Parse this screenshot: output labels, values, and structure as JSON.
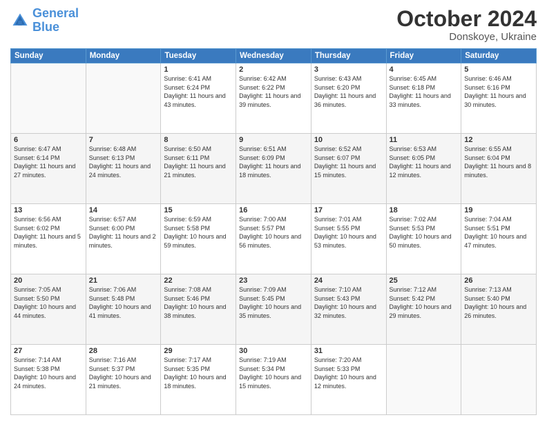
{
  "header": {
    "logo_line1": "General",
    "logo_line2": "Blue",
    "month": "October 2024",
    "location": "Donskoye, Ukraine"
  },
  "days_of_week": [
    "Sunday",
    "Monday",
    "Tuesday",
    "Wednesday",
    "Thursday",
    "Friday",
    "Saturday"
  ],
  "weeks": [
    [
      {
        "day": "",
        "info": ""
      },
      {
        "day": "",
        "info": ""
      },
      {
        "day": "1",
        "info": "Sunrise: 6:41 AM\nSunset: 6:24 PM\nDaylight: 11 hours and 43 minutes."
      },
      {
        "day": "2",
        "info": "Sunrise: 6:42 AM\nSunset: 6:22 PM\nDaylight: 11 hours and 39 minutes."
      },
      {
        "day": "3",
        "info": "Sunrise: 6:43 AM\nSunset: 6:20 PM\nDaylight: 11 hours and 36 minutes."
      },
      {
        "day": "4",
        "info": "Sunrise: 6:45 AM\nSunset: 6:18 PM\nDaylight: 11 hours and 33 minutes."
      },
      {
        "day": "5",
        "info": "Sunrise: 6:46 AM\nSunset: 6:16 PM\nDaylight: 11 hours and 30 minutes."
      }
    ],
    [
      {
        "day": "6",
        "info": "Sunrise: 6:47 AM\nSunset: 6:14 PM\nDaylight: 11 hours and 27 minutes."
      },
      {
        "day": "7",
        "info": "Sunrise: 6:48 AM\nSunset: 6:13 PM\nDaylight: 11 hours and 24 minutes."
      },
      {
        "day": "8",
        "info": "Sunrise: 6:50 AM\nSunset: 6:11 PM\nDaylight: 11 hours and 21 minutes."
      },
      {
        "day": "9",
        "info": "Sunrise: 6:51 AM\nSunset: 6:09 PM\nDaylight: 11 hours and 18 minutes."
      },
      {
        "day": "10",
        "info": "Sunrise: 6:52 AM\nSunset: 6:07 PM\nDaylight: 11 hours and 15 minutes."
      },
      {
        "day": "11",
        "info": "Sunrise: 6:53 AM\nSunset: 6:05 PM\nDaylight: 11 hours and 12 minutes."
      },
      {
        "day": "12",
        "info": "Sunrise: 6:55 AM\nSunset: 6:04 PM\nDaylight: 11 hours and 8 minutes."
      }
    ],
    [
      {
        "day": "13",
        "info": "Sunrise: 6:56 AM\nSunset: 6:02 PM\nDaylight: 11 hours and 5 minutes."
      },
      {
        "day": "14",
        "info": "Sunrise: 6:57 AM\nSunset: 6:00 PM\nDaylight: 11 hours and 2 minutes."
      },
      {
        "day": "15",
        "info": "Sunrise: 6:59 AM\nSunset: 5:58 PM\nDaylight: 10 hours and 59 minutes."
      },
      {
        "day": "16",
        "info": "Sunrise: 7:00 AM\nSunset: 5:57 PM\nDaylight: 10 hours and 56 minutes."
      },
      {
        "day": "17",
        "info": "Sunrise: 7:01 AM\nSunset: 5:55 PM\nDaylight: 10 hours and 53 minutes."
      },
      {
        "day": "18",
        "info": "Sunrise: 7:02 AM\nSunset: 5:53 PM\nDaylight: 10 hours and 50 minutes."
      },
      {
        "day": "19",
        "info": "Sunrise: 7:04 AM\nSunset: 5:51 PM\nDaylight: 10 hours and 47 minutes."
      }
    ],
    [
      {
        "day": "20",
        "info": "Sunrise: 7:05 AM\nSunset: 5:50 PM\nDaylight: 10 hours and 44 minutes."
      },
      {
        "day": "21",
        "info": "Sunrise: 7:06 AM\nSunset: 5:48 PM\nDaylight: 10 hours and 41 minutes."
      },
      {
        "day": "22",
        "info": "Sunrise: 7:08 AM\nSunset: 5:46 PM\nDaylight: 10 hours and 38 minutes."
      },
      {
        "day": "23",
        "info": "Sunrise: 7:09 AM\nSunset: 5:45 PM\nDaylight: 10 hours and 35 minutes."
      },
      {
        "day": "24",
        "info": "Sunrise: 7:10 AM\nSunset: 5:43 PM\nDaylight: 10 hours and 32 minutes."
      },
      {
        "day": "25",
        "info": "Sunrise: 7:12 AM\nSunset: 5:42 PM\nDaylight: 10 hours and 29 minutes."
      },
      {
        "day": "26",
        "info": "Sunrise: 7:13 AM\nSunset: 5:40 PM\nDaylight: 10 hours and 26 minutes."
      }
    ],
    [
      {
        "day": "27",
        "info": "Sunrise: 7:14 AM\nSunset: 5:38 PM\nDaylight: 10 hours and 24 minutes."
      },
      {
        "day": "28",
        "info": "Sunrise: 7:16 AM\nSunset: 5:37 PM\nDaylight: 10 hours and 21 minutes."
      },
      {
        "day": "29",
        "info": "Sunrise: 7:17 AM\nSunset: 5:35 PM\nDaylight: 10 hours and 18 minutes."
      },
      {
        "day": "30",
        "info": "Sunrise: 7:19 AM\nSunset: 5:34 PM\nDaylight: 10 hours and 15 minutes."
      },
      {
        "day": "31",
        "info": "Sunrise: 7:20 AM\nSunset: 5:33 PM\nDaylight: 10 hours and 12 minutes."
      },
      {
        "day": "",
        "info": ""
      },
      {
        "day": "",
        "info": ""
      }
    ]
  ]
}
